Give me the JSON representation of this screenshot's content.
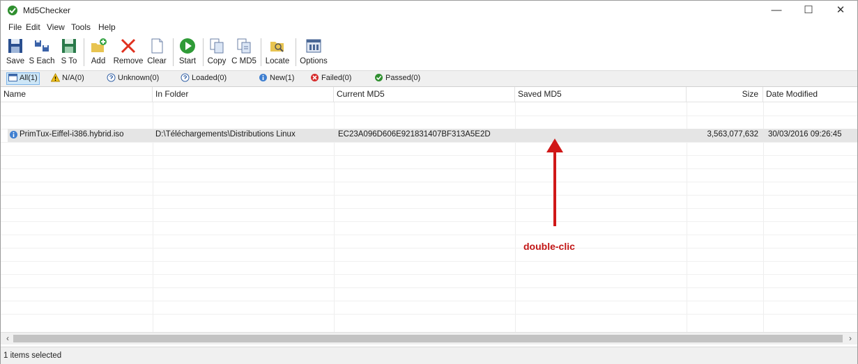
{
  "window": {
    "title": "Md5Checker",
    "controls": [
      "—",
      "☐",
      "✕"
    ]
  },
  "menu": [
    "File",
    "Edit",
    "View",
    "Tools",
    "Help"
  ],
  "toolbar": {
    "save": "Save",
    "save_each": "S Each",
    "save_to": "S To",
    "add": "Add",
    "remove": "Remove",
    "clear": "Clear",
    "start": "Start",
    "copy": "Copy",
    "copy_md5": "C MD5",
    "locate": "Locate",
    "options": "Options"
  },
  "filters": [
    {
      "label": "All(1)",
      "icon": "list-icon",
      "active": true
    },
    {
      "label": "N/A(0)",
      "icon": "warning-icon"
    },
    {
      "label": "Unknown(0)",
      "icon": "unknown-icon"
    },
    {
      "label": "Loaded(0)",
      "icon": "loaded-icon"
    },
    {
      "label": "New(1)",
      "icon": "info-icon"
    },
    {
      "label": "Failed(0)",
      "icon": "failed-icon"
    },
    {
      "label": "Passed(0)",
      "icon": "passed-icon"
    }
  ],
  "columns": [
    "Name",
    "In Folder",
    "Current MD5",
    "Saved MD5",
    "Size",
    "Date Modified"
  ],
  "rows": [
    {
      "name": "PrimTux-Eiffel-i386.hybrid.iso",
      "folder": "D:\\Téléchargements\\Distributions Linux",
      "current_md5": "EC23A096D606E921831407BF313A5E2D",
      "saved_md5": "",
      "size": "3,563,077,632",
      "date": "30/03/2016 09:26:45"
    }
  ],
  "annotation": {
    "text": "double-clic",
    "color": "#c21616"
  },
  "status": "1 items selected",
  "colors": {
    "accent": "#2f8f2f",
    "selection": "#cde6f7",
    "annotation": "#c21616"
  }
}
